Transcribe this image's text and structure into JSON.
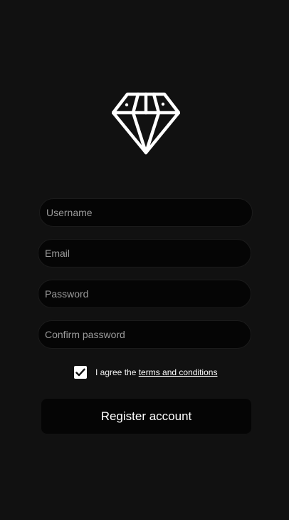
{
  "brand": {
    "logo_icon": "diamond-icon"
  },
  "form": {
    "username_placeholder": "Username",
    "email_placeholder": "Email",
    "password_placeholder": "Password",
    "confirm_placeholder": "Confirm password",
    "agree_prefix": "I agree the ",
    "terms_link": "terms and conditions",
    "agree_checked": true,
    "submit_label": "Register account"
  },
  "colors": {
    "background": "#111111",
    "field_bg": "#050505",
    "text": "#ffffff",
    "placeholder": "#9b9b9b"
  }
}
